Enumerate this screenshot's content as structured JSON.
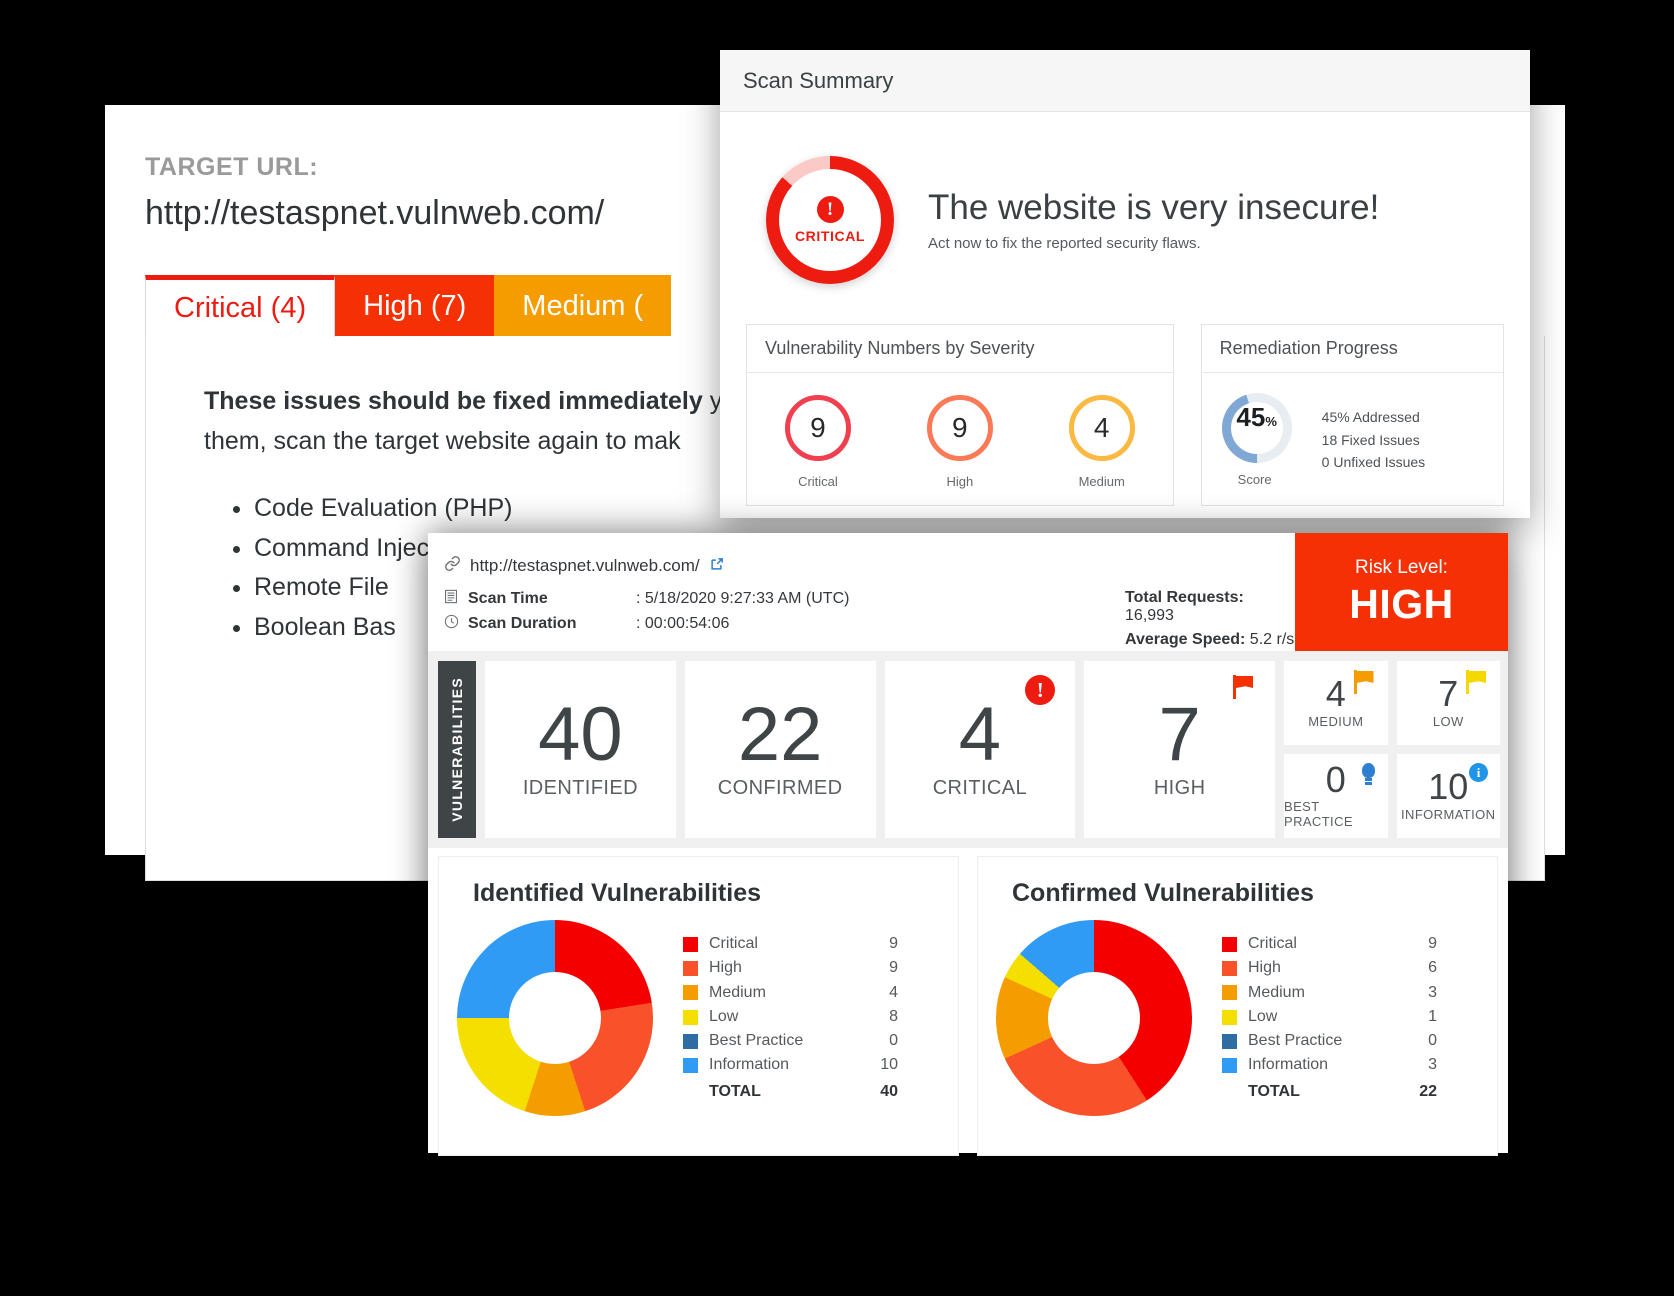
{
  "report_panel": {
    "target_label": "TARGET URL:",
    "target_url": "http://testaspnet.vulnweb.com/",
    "tabs": [
      {
        "label": "Critical (4)",
        "state": "active"
      },
      {
        "label": "High (7)",
        "state": "high"
      },
      {
        "label": "Medium (",
        "state": "medium"
      }
    ],
    "lead_bold": "These issues should be fixed immediately",
    "lead_rest": " you",
    "lead_line2": "them, scan the target website again to mak",
    "issues": [
      "Code Evaluation (PHP)",
      "Command Injection",
      "Remote File",
      "Boolean Bas"
    ]
  },
  "scan_summary": {
    "title": "Scan Summary",
    "gauge": {
      "label": "CRITICAL",
      "icon": "!"
    },
    "hero_title": "The website is very insecure!",
    "hero_sub": "Act now to fix the reported security flaws.",
    "severity_card": {
      "title": "Vulnerability Numbers by Severity",
      "items": [
        {
          "value": "9",
          "caption": "Critical",
          "color": "#f04050"
        },
        {
          "value": "9",
          "caption": "High",
          "color": "#fa7a58"
        },
        {
          "value": "4",
          "caption": "Medium",
          "color": "#fcb942"
        }
      ]
    },
    "remediation_card": {
      "title": "Remediation Progress",
      "score_value": "45",
      "score_unit": "%",
      "score_caption": "Score",
      "facts": [
        "45% Addressed",
        "18 Fixed Issues",
        "0 Unfixed Issues"
      ]
    }
  },
  "dashboard": {
    "url": "http://testaspnet.vulnweb.com/",
    "external_icon": "↗",
    "link_icon": "🔗",
    "meta": [
      {
        "icon": "▤",
        "key": "Scan Time",
        "value": ": 5/18/2020 9:27:33 AM (UTC)"
      },
      {
        "icon": "◷",
        "key": "Scan Duration",
        "value": ": 00:00:54:06"
      }
    ],
    "stats_right": [
      {
        "key": "Total Requests:",
        "value": " 16,993"
      },
      {
        "key": "Average Speed:",
        "value": " 5.2 r/s"
      }
    ],
    "risk": {
      "caption": "Risk Level:",
      "value": "HIGH",
      "color": "#f63005"
    },
    "vuln_tag": "VULNERABILITIES",
    "big_stats": [
      {
        "value": "40",
        "caption": "IDENTIFIED",
        "icon": ""
      },
      {
        "value": "22",
        "caption": "CONFIRMED",
        "icon": ""
      },
      {
        "value": "4",
        "caption": "CRITICAL",
        "icon": "exclamation-circle-icon"
      },
      {
        "value": "7",
        "caption": "HIGH",
        "icon": "red-flag-icon"
      }
    ],
    "small_stats": [
      {
        "value": "4",
        "caption": "MEDIUM",
        "icon": "orange-flag-icon"
      },
      {
        "value": "7",
        "caption": "LOW",
        "icon": "yellow-flag-icon"
      },
      {
        "value": "0",
        "caption": "BEST PRACTICE",
        "icon": "lightbulb-icon"
      },
      {
        "value": "10",
        "caption": "INFORMATION",
        "icon": "info-icon"
      }
    ]
  },
  "chart_data": [
    {
      "type": "pie",
      "title": "Identified Vulnerabilities",
      "categories": [
        "Critical",
        "High",
        "Medium",
        "Low",
        "Best Practice",
        "Information"
      ],
      "values": [
        9,
        9,
        4,
        8,
        0,
        10
      ],
      "colors": [
        "#f50000",
        "#f9522a",
        "#f59c00",
        "#f5df00",
        "#2e6da4",
        "#2f9bf5"
      ],
      "total_label": "TOTAL",
      "total_value": 40,
      "legend_position": "right"
    },
    {
      "type": "pie",
      "title": "Confirmed Vulnerabilities",
      "categories": [
        "Critical",
        "High",
        "Medium",
        "Low",
        "Best Practice",
        "Information"
      ],
      "values": [
        9,
        6,
        3,
        1,
        0,
        3
      ],
      "colors": [
        "#f50000",
        "#f9522a",
        "#f59c00",
        "#f5df00",
        "#2e6da4",
        "#2f9bf5"
      ],
      "total_label": "TOTAL",
      "total_value": 22,
      "legend_position": "right"
    }
  ]
}
